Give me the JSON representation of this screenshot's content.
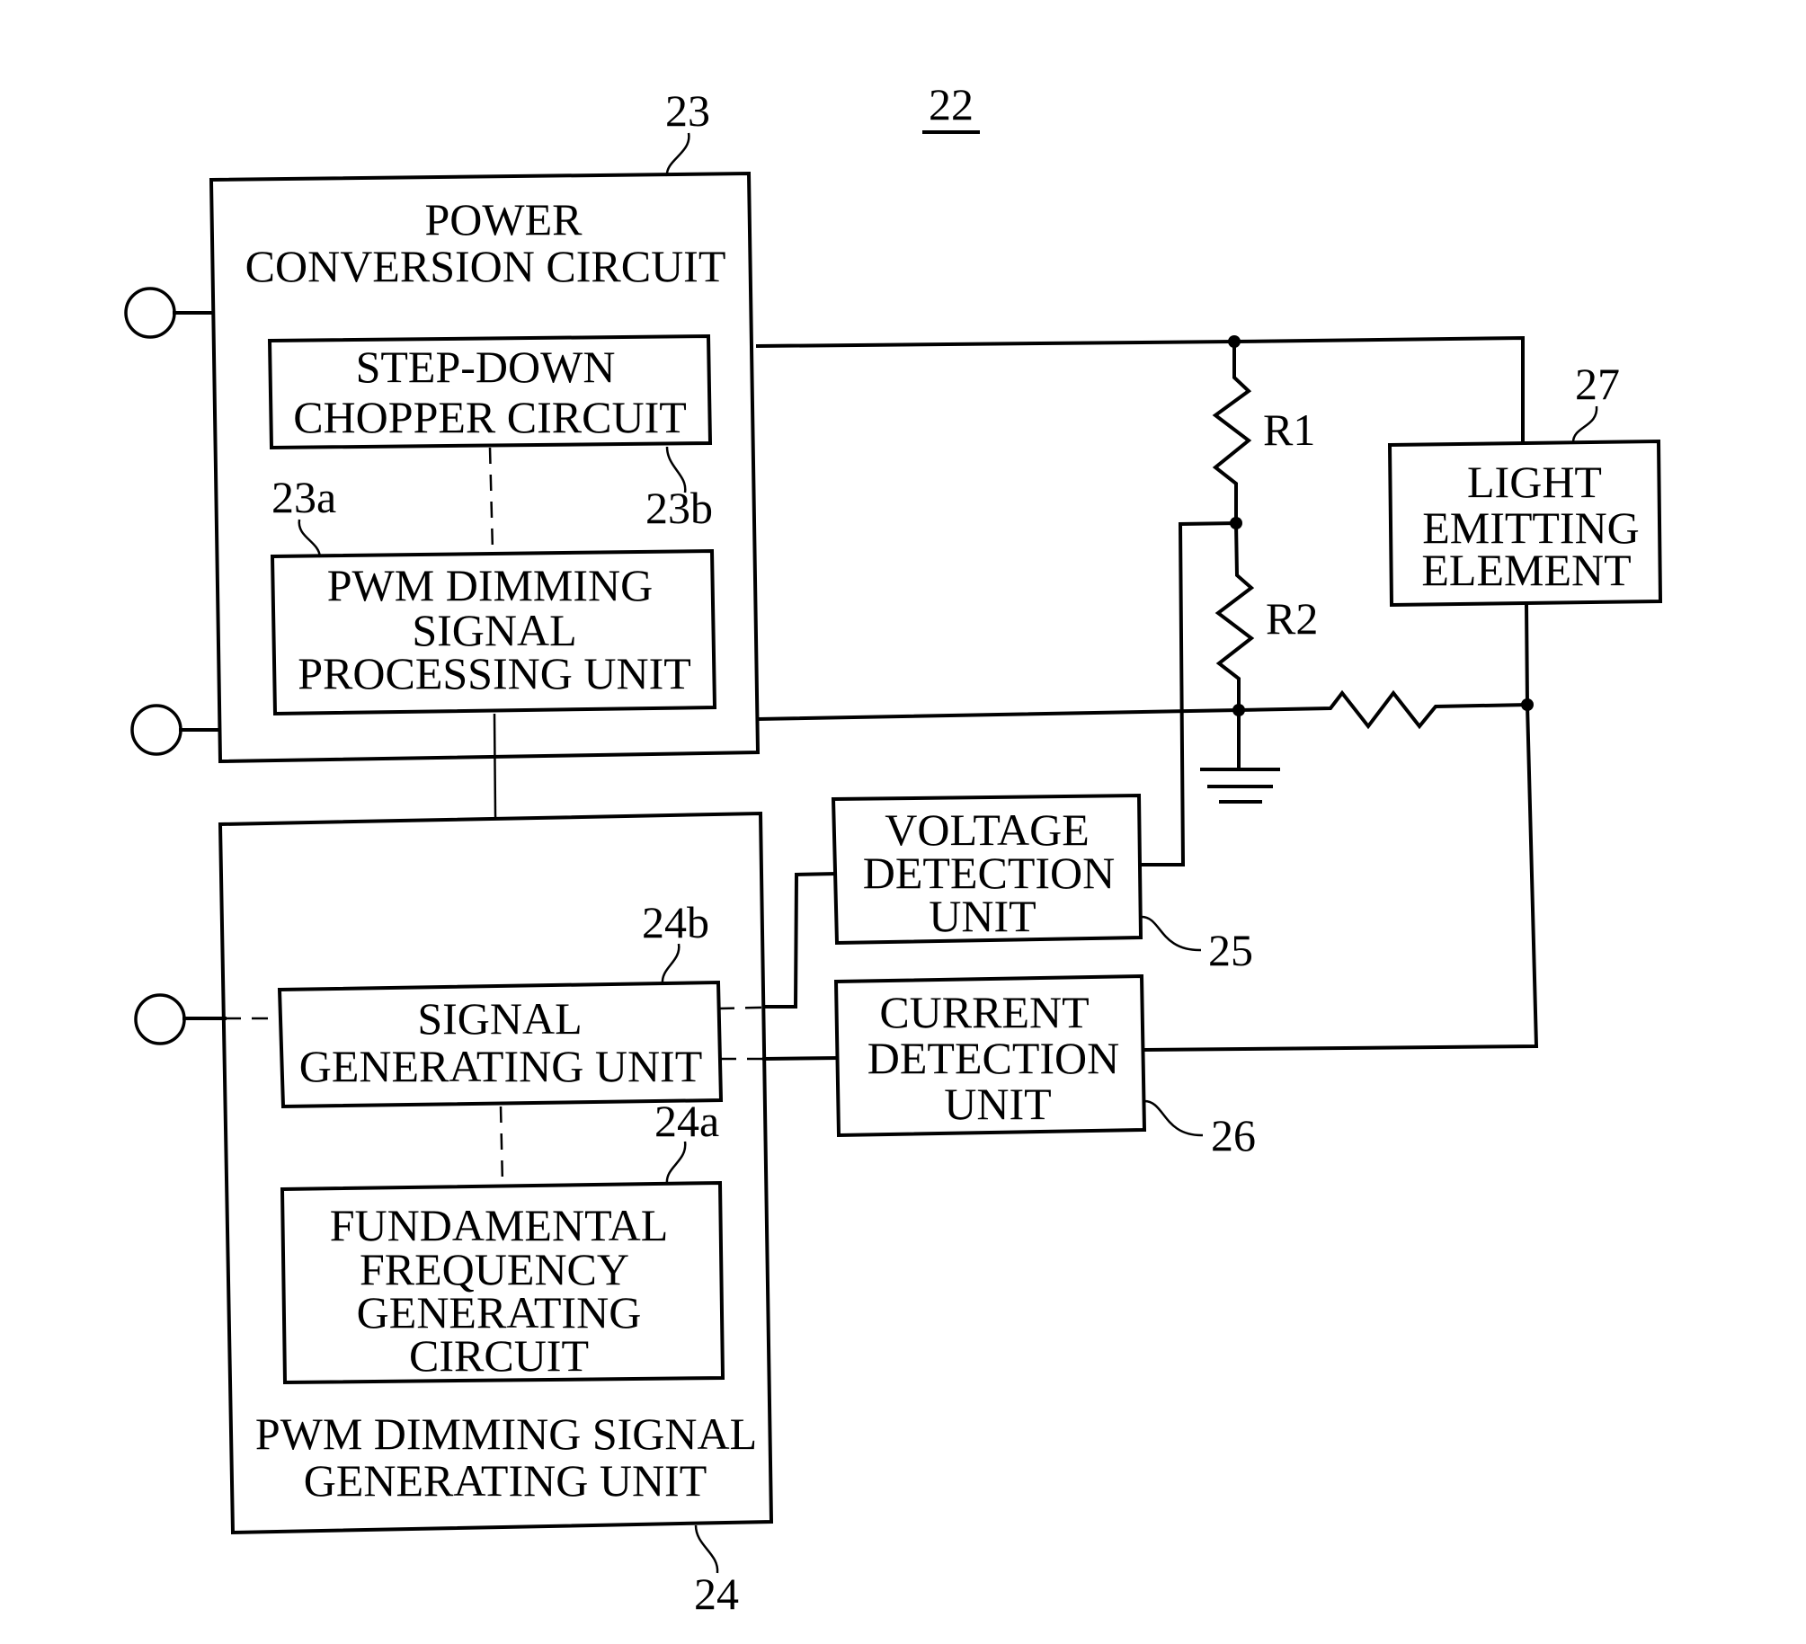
{
  "figure": {
    "reference": "22",
    "blocks": {
      "power_conversion": {
        "ref": "23",
        "lines": [
          "POWER",
          "CONVERSION CIRCUIT"
        ]
      },
      "step_down_chopper": {
        "ref": "23b",
        "lines": [
          "STEP-DOWN",
          "CHOPPER CIRCUIT"
        ]
      },
      "pwm_processing": {
        "ref": "23a",
        "lines": [
          "PWM DIMMING",
          "SIGNAL",
          "PROCESSING UNIT"
        ]
      },
      "pwm_generating": {
        "ref": "24",
        "lines": [
          "PWM DIMMING SIGNAL",
          "GENERATING UNIT"
        ]
      },
      "signal_generating": {
        "ref": "24b",
        "lines": [
          "SIGNAL",
          "GENERATING UNIT"
        ]
      },
      "fundamental_frequency": {
        "ref": "24a",
        "lines": [
          "FUNDAMENTAL",
          "FREQUENCY",
          "GENERATING",
          "CIRCUIT"
        ]
      },
      "voltage_detection": {
        "ref": "25",
        "lines": [
          "VOLTAGE",
          "DETECTION",
          "UNIT"
        ]
      },
      "current_detection": {
        "ref": "26",
        "lines": [
          "CURRENT",
          "DETECTION",
          "UNIT"
        ]
      },
      "light_emitting": {
        "ref": "27",
        "lines": [
          "LIGHT",
          "EMITTING",
          "ELEMENT"
        ]
      }
    },
    "resistors": {
      "r1": "R1",
      "r2": "R2"
    }
  }
}
